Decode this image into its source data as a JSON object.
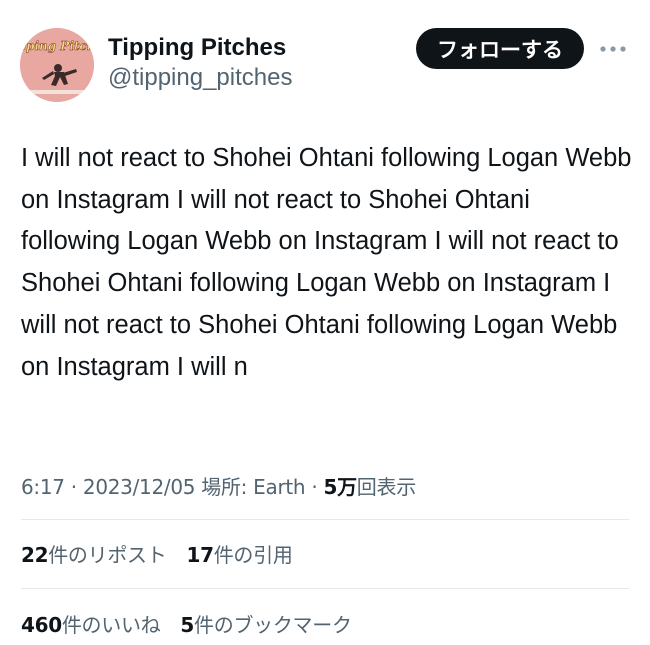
{
  "user": {
    "display_name": "Tipping Pitches",
    "handle": "@tipping_pitches",
    "avatar_text": "Tipping Pitches"
  },
  "actions": {
    "follow_label": "フォローする",
    "more_icon": "more-horizontal-icon"
  },
  "tweet": {
    "text": "I will not react to Shohei Ohtani following Logan Webb on Instagram I will not react to Shohei Ohtani following Logan Webb on Instagram I will not react to Shohei Ohtani following Logan Webb on Instagram I will not react to Shohei Ohtani following Logan Webb on Instagram I will n"
  },
  "meta": {
    "time": "6:17",
    "separator": "·",
    "date": "2023/12/05",
    "location_label": "場所: Earth",
    "views_count": "5万",
    "views_label": "回表示"
  },
  "stats": {
    "reposts": {
      "count": "22",
      "label": "件のリポスト"
    },
    "quotes": {
      "count": "17",
      "label": "件の引用"
    },
    "likes": {
      "count": "460",
      "label": "件のいいね"
    },
    "bookmarks": {
      "count": "5",
      "label": "件のブックマーク"
    }
  },
  "colors": {
    "text_primary": "#0f1419",
    "text_secondary": "#536471",
    "button_bg": "#0f1419",
    "divider": "#e6e9ec",
    "avatar_bg": "#e9a7a1"
  }
}
